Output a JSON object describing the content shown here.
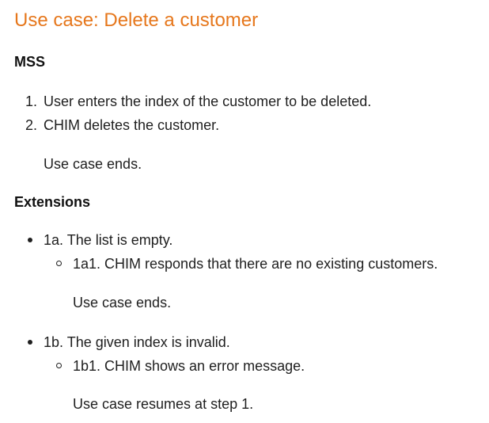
{
  "title": "Use case: Delete a customer",
  "mss": {
    "heading": "MSS",
    "steps": [
      {
        "number": "1.",
        "text": "User enters the index of the customer to be deleted."
      },
      {
        "number": "2.",
        "text": "CHIM deletes the customer."
      }
    ],
    "ending": "Use case ends."
  },
  "extensions": {
    "heading": "Extensions",
    "items": [
      {
        "text": "1a. The list is empty.",
        "sub": {
          "text": "1a1. CHIM responds that there are no existing customers.",
          "ending": "Use case ends."
        }
      },
      {
        "text": "1b. The given index is invalid.",
        "sub": {
          "text": "1b1. CHIM shows an error message.",
          "ending": "Use case resumes at step 1."
        }
      }
    ]
  }
}
